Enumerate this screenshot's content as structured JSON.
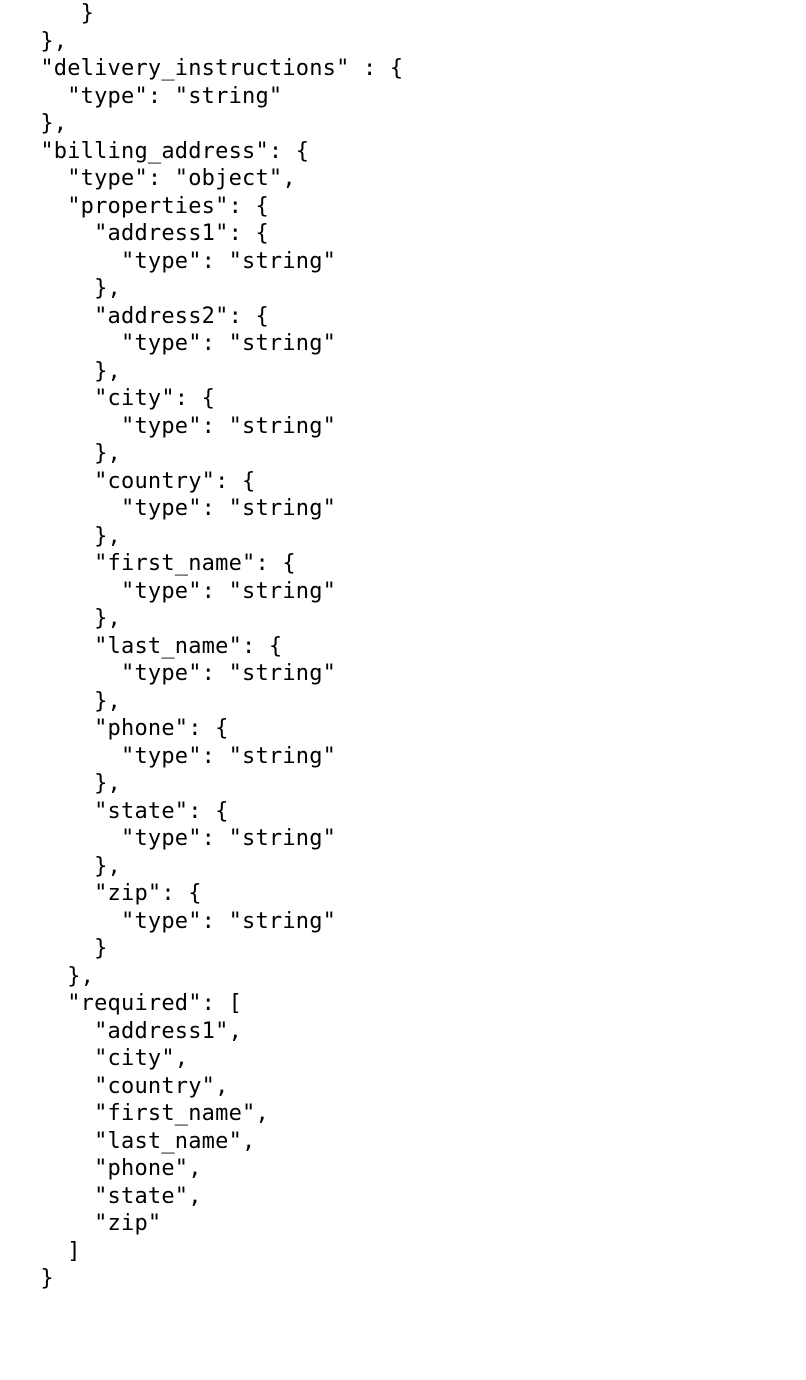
{
  "code_lines": [
    "      }",
    "   },",
    "   \"delivery_instructions\" : {",
    "     \"type\": \"string\"",
    "   },",
    "   \"billing_address\": {",
    "     \"type\": \"object\",",
    "     \"properties\": {",
    "       \"address1\": {",
    "         \"type\": \"string\"",
    "       },",
    "       \"address2\": {",
    "         \"type\": \"string\"",
    "       },",
    "       \"city\": {",
    "         \"type\": \"string\"",
    "       },",
    "       \"country\": {",
    "         \"type\": \"string\"",
    "       },",
    "       \"first_name\": {",
    "         \"type\": \"string\"",
    "       },",
    "       \"last_name\": {",
    "         \"type\": \"string\"",
    "       },",
    "       \"phone\": {",
    "         \"type\": \"string\"",
    "       },",
    "       \"state\": {",
    "         \"type\": \"string\"",
    "       },",
    "       \"zip\": {",
    "         \"type\": \"string\"",
    "       }",
    "     },",
    "     \"required\": [",
    "       \"address1\",",
    "       \"city\",",
    "       \"country\",",
    "       \"first_name\",",
    "       \"last_name\",",
    "       \"phone\",",
    "       \"state\",",
    "       \"zip\"",
    "     ]",
    "   }"
  ]
}
